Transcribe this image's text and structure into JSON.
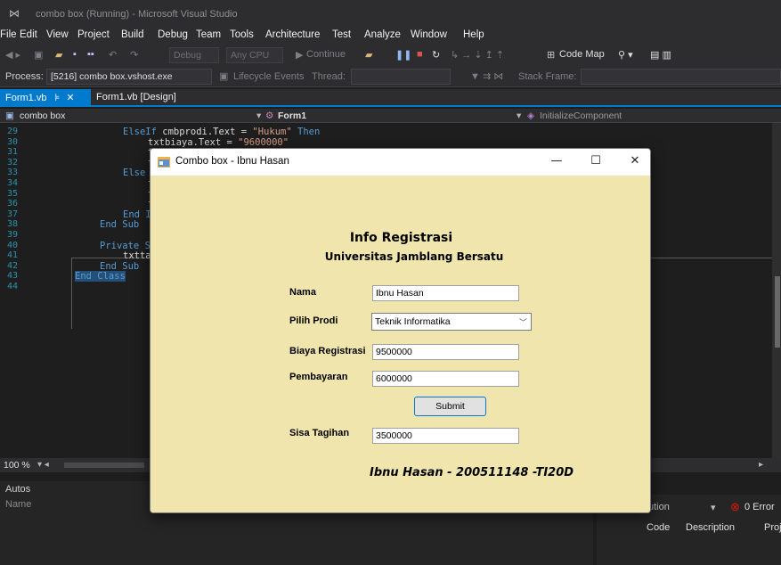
{
  "ide": {
    "window_title": "combo box (Running) - Microsoft Visual Studio",
    "menu": [
      "File",
      "Edit",
      "View",
      "Project",
      "Build",
      "Debug",
      "Team",
      "Tools",
      "Architecture",
      "Test",
      "Analyze",
      "Window",
      "Help"
    ],
    "toolbar": {
      "config": "Debug",
      "platform": "Any CPU",
      "continue": "Continue",
      "code_map": "Code Map"
    },
    "process_bar": {
      "process_label": "Process:",
      "process_value": "[5216] combo box.vshost.exe",
      "lifecycle": "Lifecycle Events",
      "thread_label": "Thread:",
      "stack_frame_label": "Stack Frame:"
    },
    "tabs": {
      "active": "Form1.vb",
      "inactive": "Form1.vb [Design]"
    },
    "nav": {
      "project": "combo box",
      "class": "Form1",
      "member": "InitializeComponent"
    },
    "code_lines": [
      {
        "n": "29",
        "kw1": "ElseIf",
        "text": " cmbprodi.Text = ",
        "str": "\"Hukum\"",
        "kw2": " Then"
      },
      {
        "n": "30",
        "kw1": "",
        "text": "txtbiaya.Text = ",
        "str": "\"9600000\"",
        "kw2": ""
      },
      {
        "n": "31",
        "kw1": "",
        "text": "t",
        "str": "",
        "kw2": ""
      },
      {
        "n": "32",
        "kw1": "",
        "text": "t",
        "str": "",
        "kw2": ""
      },
      {
        "n": "33",
        "kw1": "Else",
        "text": "",
        "str": "",
        "kw2": ""
      },
      {
        "n": "34",
        "kw1": "",
        "text": "t",
        "str": "",
        "kw2": ""
      },
      {
        "n": "35",
        "kw1": "",
        "text": "t",
        "str": "",
        "kw2": ""
      },
      {
        "n": "36",
        "kw1": "",
        "text": "t",
        "str": "",
        "kw2": ""
      },
      {
        "n": "37",
        "kw1": "End I",
        "text": "",
        "str": "",
        "kw2": ""
      },
      {
        "n": "38",
        "kw1": "End Sub",
        "text": "",
        "str": "",
        "kw2": ""
      },
      {
        "n": "39",
        "kw1": "",
        "text": "",
        "str": "",
        "kw2": ""
      },
      {
        "n": "40",
        "kw1": "Private S",
        "text": "",
        "str": "",
        "kw2": ""
      },
      {
        "n": "41",
        "kw1": "",
        "text": "txtta",
        "str": "",
        "kw2": ""
      },
      {
        "n": "42",
        "kw1": "End Sub",
        "text": "",
        "str": "",
        "kw2": ""
      },
      {
        "n": "43",
        "kw1": "End Class",
        "text": "",
        "str": "",
        "kw2": ""
      },
      {
        "n": "44",
        "kw1": "",
        "text": "",
        "str": "",
        "kw2": ""
      }
    ],
    "zoom": "100 %",
    "autos": {
      "title": "Autos",
      "column": "Name"
    },
    "error_list": {
      "solution": "ution",
      "errors": "0 Error",
      "col_code": "Code",
      "col_desc": "Description",
      "col_proj": "Proj"
    }
  },
  "form": {
    "title": "Combo box - Ibnu Hasan",
    "heading": "Info Registrasi",
    "subheading": "Universitas Jamblang Bersatu",
    "nama_label": "Nama",
    "nama_value": "Ibnu Hasan",
    "prodi_label": "Pilih Prodi",
    "prodi_value": "Teknik Informatika",
    "biaya_label": "Biaya Registrasi",
    "biaya_value": "9500000",
    "bayar_label": "Pembayaran",
    "bayar_value": "6000000",
    "submit_label": "Submit",
    "sisa_label": "Sisa Tagihan",
    "sisa_value": "3500000",
    "footer": "Ibnu Hasan - 200511148 -TI20D"
  }
}
